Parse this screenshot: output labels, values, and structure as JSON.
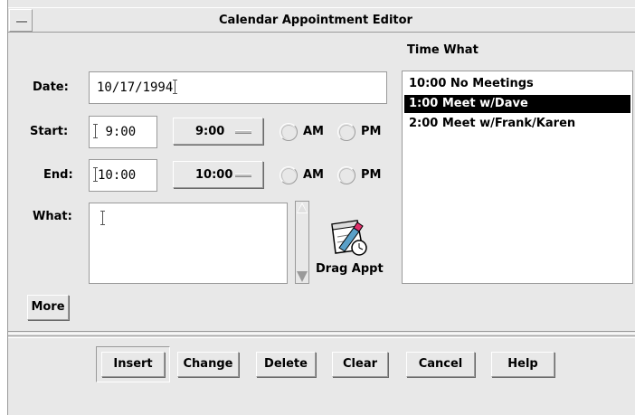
{
  "window": {
    "title": "Calendar Appointment Editor"
  },
  "form": {
    "date_label": "Date:",
    "date_value": "10/17/1994",
    "start_label": "Start:",
    "start_value": "9:00",
    "start_menu": "9:00",
    "end_label": "End:",
    "end_value": "10:00",
    "end_menu": "10:00",
    "am_label": "AM",
    "pm_label": "PM",
    "what_label": "What:",
    "what_value": "",
    "drag_label": "Drag Appt",
    "more_label": "More"
  },
  "list": {
    "header": "Time  What",
    "items": [
      {
        "text": "10:00 No Meetings",
        "selected": false
      },
      {
        "text": "1:00 Meet w/Dave",
        "selected": true
      },
      {
        "text": "2:00 Meet w/Frank/Karen",
        "selected": false
      }
    ]
  },
  "buttons": {
    "insert": "Insert",
    "change": "Change",
    "delete": "Delete",
    "clear": "Clear",
    "cancel": "Cancel",
    "help": "Help"
  },
  "icons": {
    "window_menu": "window-menu-icon",
    "drag": "calendar-clock-icon"
  }
}
